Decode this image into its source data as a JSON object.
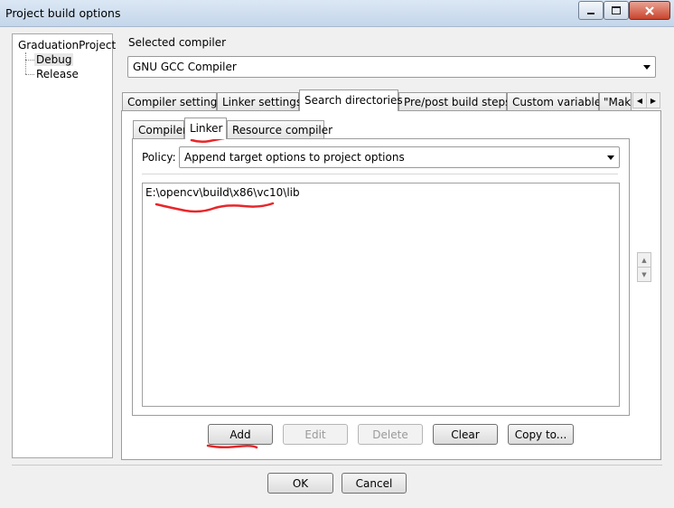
{
  "window": {
    "title": "Project build options"
  },
  "tree": {
    "root": "GraduationProject",
    "children": [
      "Debug",
      "Release"
    ]
  },
  "compiler": {
    "label": "Selected compiler",
    "value": "GNU GCC Compiler"
  },
  "tabs": [
    "Compiler settings",
    "Linker settings",
    "Search directories",
    "Pre/post build steps",
    "Custom variables",
    "\"Make"
  ],
  "active_tab": "Search directories",
  "subtabs": [
    "Compiler",
    "Linker",
    "Resource compiler"
  ],
  "active_subtab": "Linker",
  "policy": {
    "label": "Policy:",
    "value": "Append target options to project options"
  },
  "directories": [
    "E:\\opencv\\build\\x86\\vc10\\lib"
  ],
  "buttons": {
    "add": "Add",
    "edit": "Edit",
    "delete": "Delete",
    "clear": "Clear",
    "copy_to": "Copy to..."
  },
  "dialog": {
    "ok": "OK",
    "cancel": "Cancel"
  },
  "annotation_color": "#e8262a"
}
